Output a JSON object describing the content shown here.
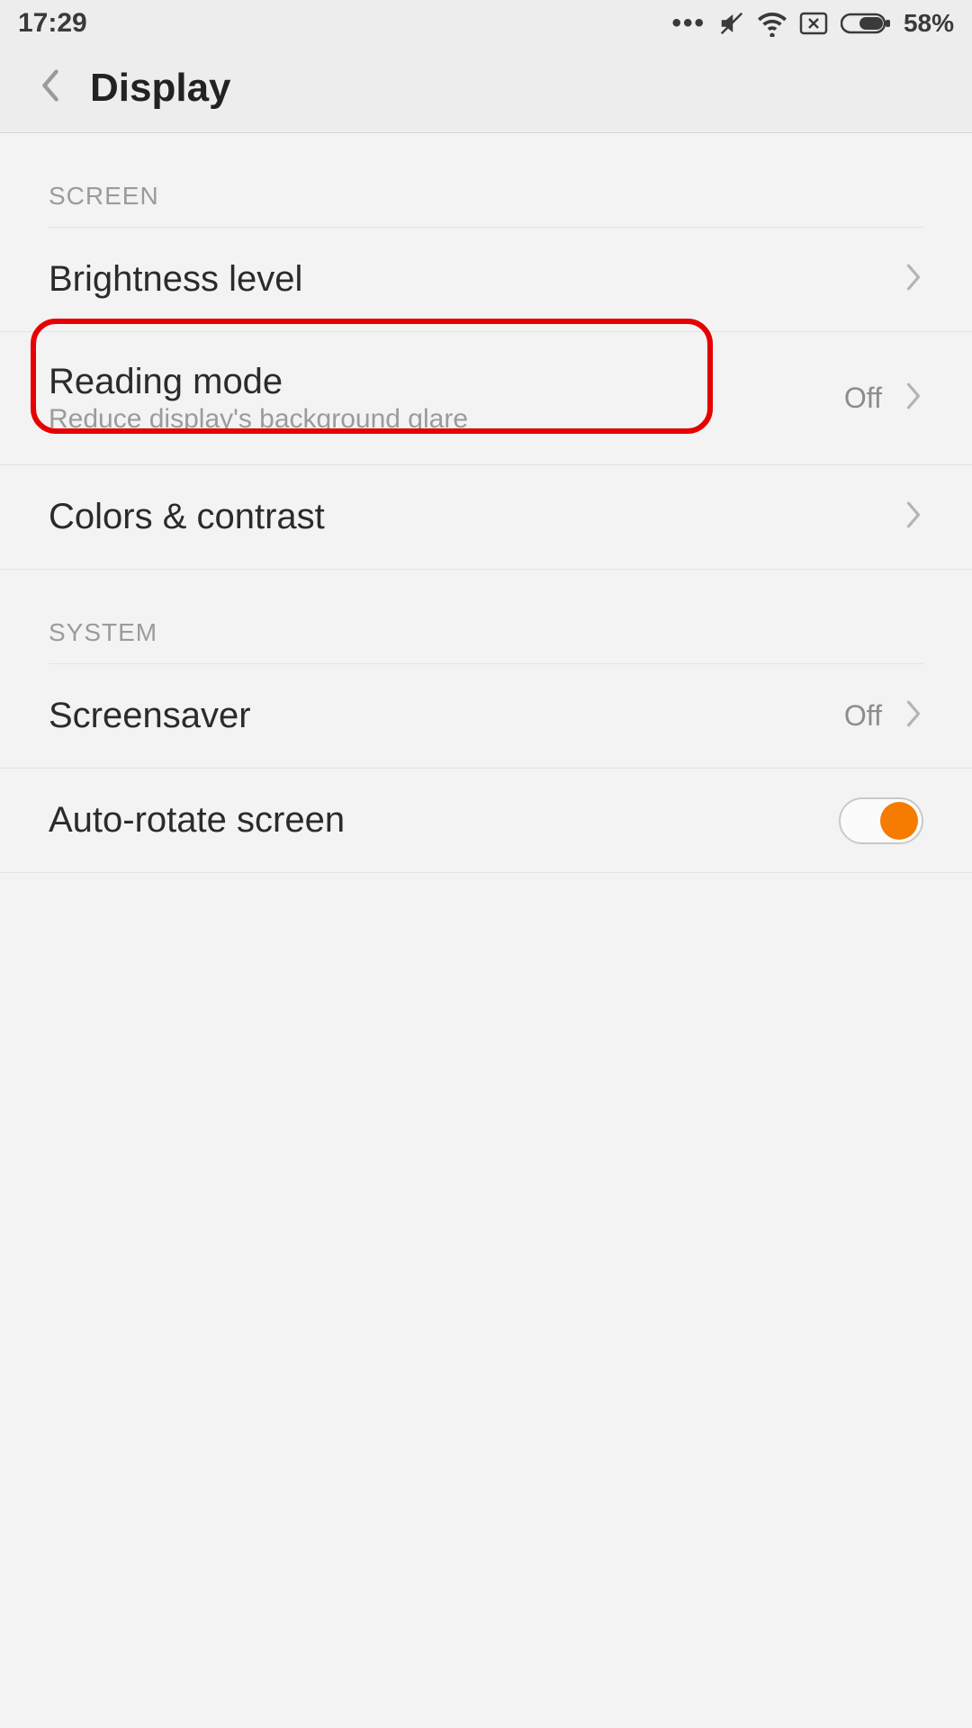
{
  "status": {
    "time": "17:29",
    "battery_text": "58%"
  },
  "header": {
    "title": "Display"
  },
  "sections": {
    "screen": {
      "label": "SCREEN",
      "brightness": {
        "title": "Brightness level"
      },
      "reading_mode": {
        "title": "Reading mode",
        "subtitle": "Reduce display's background glare",
        "value": "Off"
      },
      "colors": {
        "title": "Colors & contrast"
      }
    },
    "system": {
      "label": "SYSTEM",
      "screensaver": {
        "title": "Screensaver",
        "value": "Off"
      },
      "autorotate": {
        "title": "Auto-rotate screen",
        "on": true
      }
    }
  }
}
